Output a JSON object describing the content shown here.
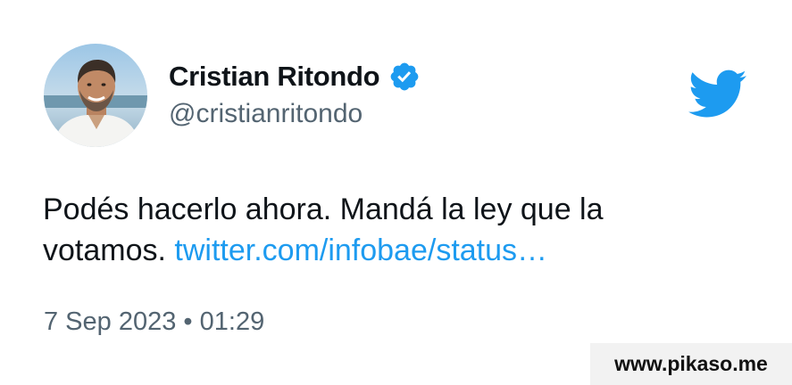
{
  "author": {
    "display_name": "Cristian Ritondo",
    "handle": "@cristianritondo",
    "verified": true
  },
  "tweet": {
    "text": "Podés hacerlo ahora. Mandá la ley que la votamos.",
    "link_text": "twitter.com/infobae/status…",
    "date": "7 Sep 2023",
    "separator": "•",
    "time": "01:29"
  },
  "icons": {
    "verified": "verified-badge-icon",
    "brand": "twitter-bird-icon"
  },
  "colors": {
    "brand_blue": "#1d9bf0",
    "secondary_text": "#536471",
    "primary_text": "#0f1419"
  },
  "watermark": {
    "text": "www.pikaso.me"
  }
}
